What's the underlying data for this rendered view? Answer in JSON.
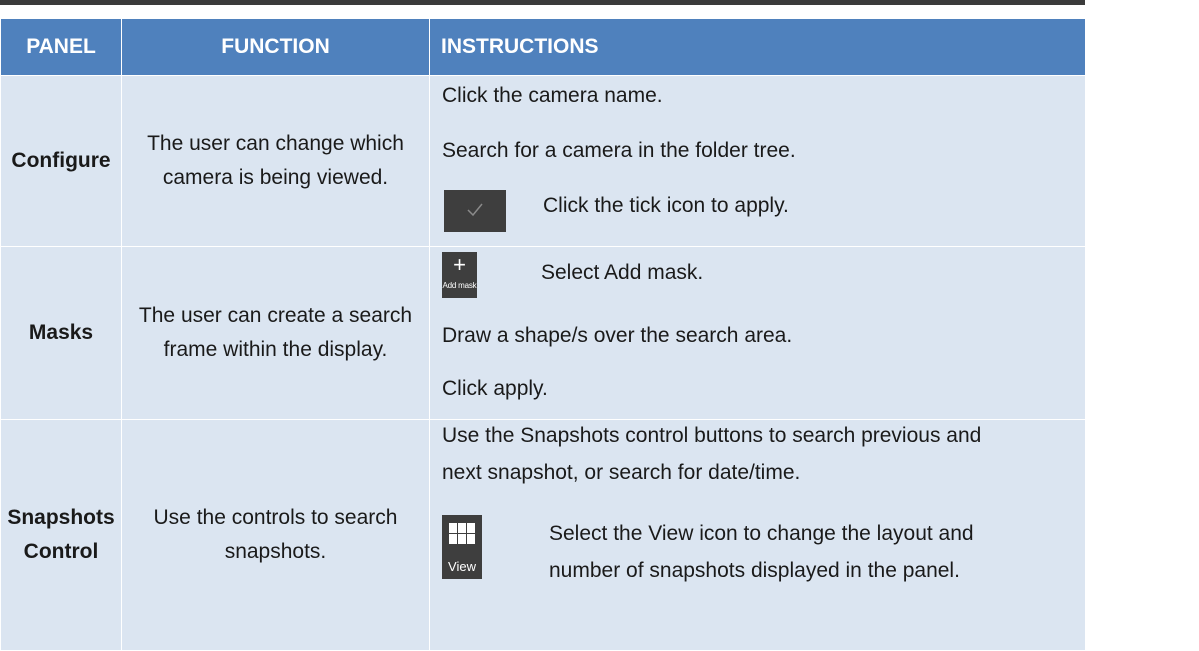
{
  "table": {
    "headers": {
      "panel": "PANEL",
      "function": "FUNCTION",
      "instructions": "INSTRUCTIONS"
    },
    "rows": [
      {
        "panel": "Configure",
        "function": "The user can change which camera is being viewed.",
        "instructions": [
          "Click the camera name.",
          "Search for a camera in the folder tree.",
          "Click the tick icon to apply."
        ],
        "icon": "tick-icon"
      },
      {
        "panel": "Masks",
        "function": "The user can create a search frame within the display.",
        "instructions": [
          "Select Add mask.",
          "Draw a shape/s over the search area.",
          "Click apply."
        ],
        "icon": "plus-icon",
        "icon_label": "Add mask"
      },
      {
        "panel_line1": "Snapshots",
        "panel_line2": "Control",
        "function": "Use the controls to search snapshots.",
        "instructions": [
          "Use the Snapshots control buttons to search previous and",
          "next snapshot, or search for date/time.",
          "Select the View icon to change the layout and",
          "number of snapshots displayed in the panel."
        ],
        "icon": "grid-icon",
        "icon_label": "View"
      }
    ]
  },
  "colors": {
    "header_bg": "#4f81bd",
    "row_bg": "#dbe5f1",
    "icon_bg": "#3e3e3e"
  }
}
